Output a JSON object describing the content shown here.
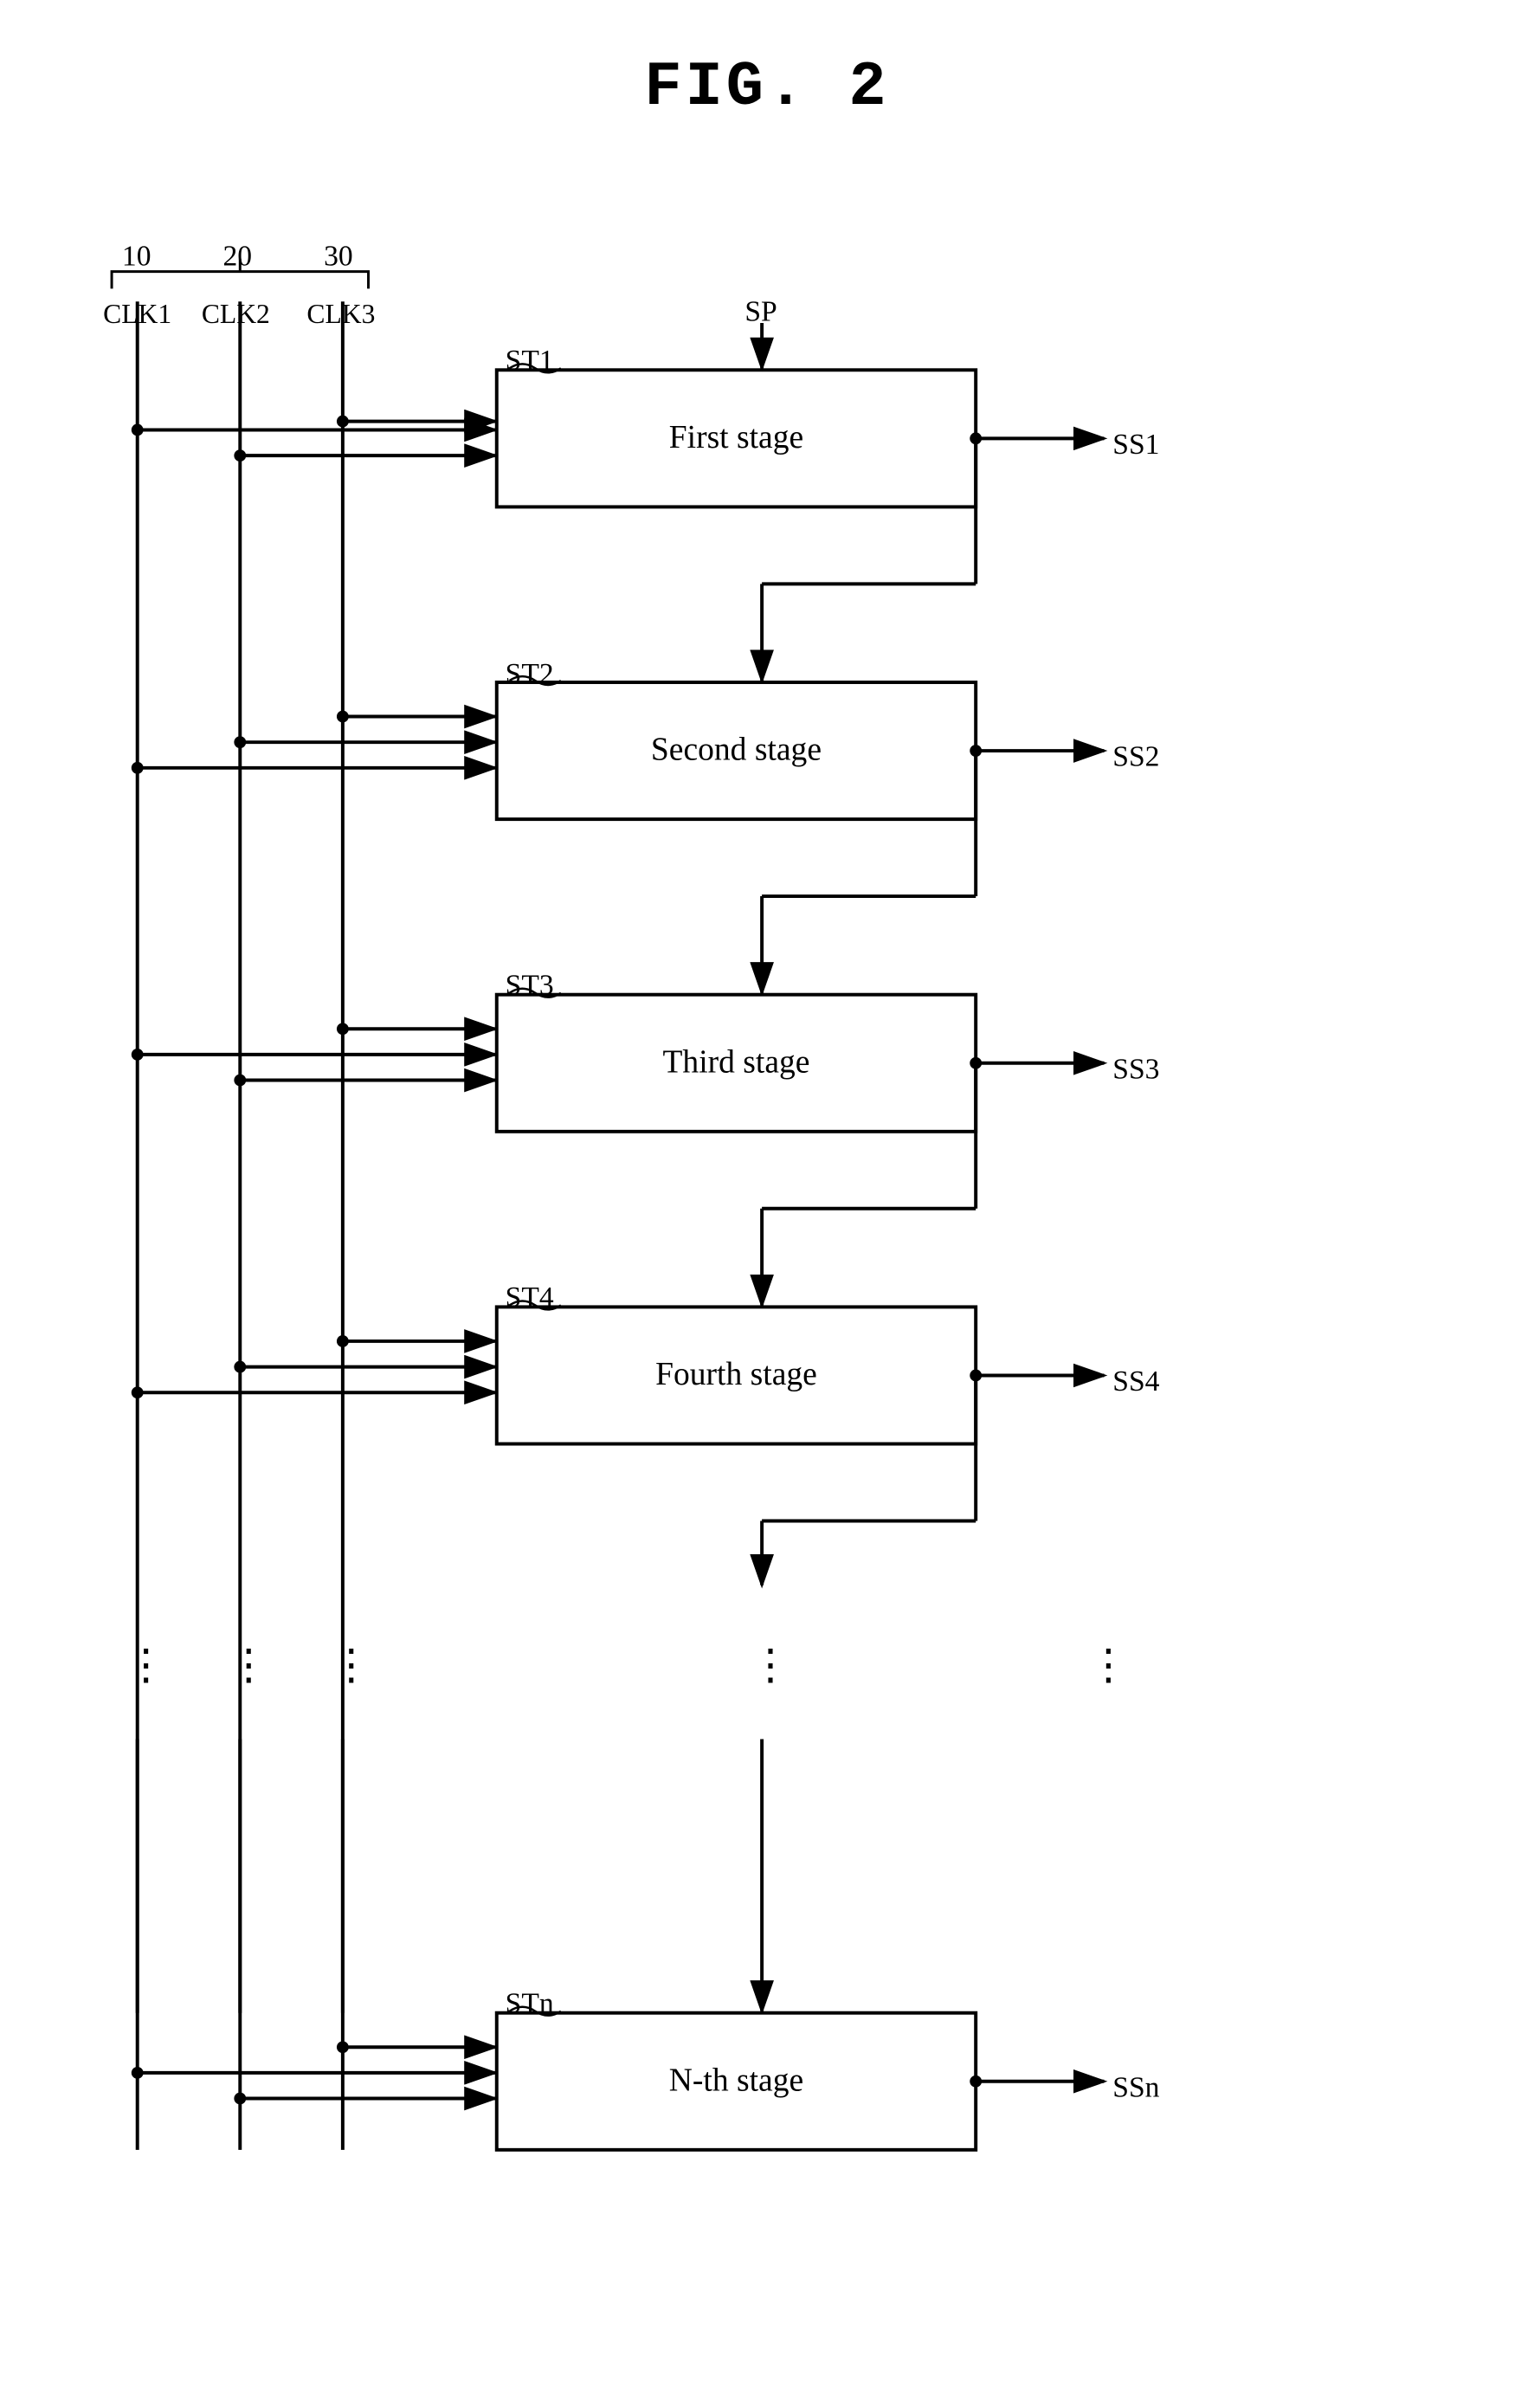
{
  "title": "FIG. 2",
  "stages": [
    {
      "id": "first",
      "label": "First stage",
      "output": "SS1",
      "input": "ST1"
    },
    {
      "id": "second",
      "label": "Second stage",
      "output": "SS2",
      "input": "ST2"
    },
    {
      "id": "third",
      "label": "Third stage",
      "output": "SS3",
      "input": "ST3"
    },
    {
      "id": "fourth",
      "label": "Fourth stage",
      "output": "SS4",
      "input": "ST4"
    },
    {
      "id": "nth",
      "label": "N-th stage",
      "output": "SSn",
      "input": "STn"
    }
  ],
  "clocks": [
    "CLK1",
    "CLK2",
    "CLK3"
  ],
  "clock_labels": [
    "10",
    "20",
    "30"
  ],
  "sp_label": "SP"
}
